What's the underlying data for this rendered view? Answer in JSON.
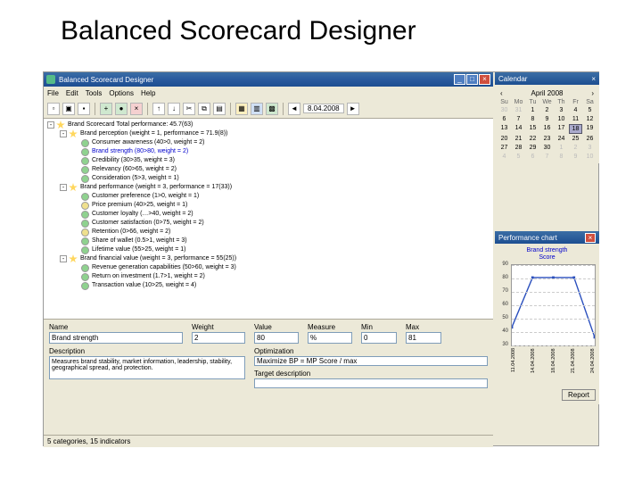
{
  "slide_title": "Balanced Scorecard Designer",
  "app": {
    "title": "Balanced Scorecard Designer",
    "window_buttons": {
      "min": "_",
      "max": "□",
      "close": "×"
    },
    "menu": [
      "File",
      "Edit",
      "Tools",
      "Options",
      "Help"
    ],
    "toolbar_date": "8.04.2008",
    "tree": [
      {
        "indent": 0,
        "exp": "-",
        "icon": "star",
        "text": "Brand Scorecard Total performance: 45.7(63)"
      },
      {
        "indent": 1,
        "exp": "-",
        "icon": "star",
        "text": "Brand perception (weight = 1, performance = 71.9(8))"
      },
      {
        "indent": 2,
        "exp": "",
        "icon": "green",
        "text": "Consumer awareness (40>0, weight = 2)"
      },
      {
        "indent": 2,
        "exp": "",
        "icon": "green",
        "text": "Brand strength (80>80, weight = 2)",
        "blue": true
      },
      {
        "indent": 2,
        "exp": "",
        "icon": "green",
        "text": "Credibility (30>35, weight = 3)"
      },
      {
        "indent": 2,
        "exp": "",
        "icon": "green",
        "text": "Relevancy (60>65, weight = 2)"
      },
      {
        "indent": 2,
        "exp": "",
        "icon": "green",
        "text": "Consideration (5>3, weight = 1)"
      },
      {
        "indent": 1,
        "exp": "-",
        "icon": "star",
        "text": "Brand performance (weight = 3, performance = 17(33))"
      },
      {
        "indent": 2,
        "exp": "",
        "icon": "green",
        "text": "Customer preference (1>0, weight = 1)"
      },
      {
        "indent": 2,
        "exp": "",
        "icon": "yellow",
        "text": "Price premium (40>25, weight = 1)"
      },
      {
        "indent": 2,
        "exp": "",
        "icon": "green",
        "text": "Customer loyalty (…>40, weight = 2)"
      },
      {
        "indent": 2,
        "exp": "",
        "icon": "green",
        "text": "Customer satisfaction (0>75, weight = 2)"
      },
      {
        "indent": 2,
        "exp": "",
        "icon": "yellow",
        "text": "Retention (0>66, weight = 2)"
      },
      {
        "indent": 2,
        "exp": "",
        "icon": "green",
        "text": "Share of wallet (0.5>1, weight = 3)"
      },
      {
        "indent": 2,
        "exp": "",
        "icon": "green",
        "text": "Lifetime value (55>25, weight = 1)"
      },
      {
        "indent": 1,
        "exp": "-",
        "icon": "star",
        "text": "Brand financial value (weight = 3, performance = 55(25))"
      },
      {
        "indent": 2,
        "exp": "",
        "icon": "green",
        "text": "Revenue generation capabilities (50>60, weight = 3)"
      },
      {
        "indent": 2,
        "exp": "",
        "icon": "green",
        "text": "Return on investment (1.7>1, weight = 2)"
      },
      {
        "indent": 2,
        "exp": "",
        "icon": "green",
        "text": "Transaction value (10>25, weight = 4)"
      }
    ],
    "form": {
      "labels": {
        "name": "Name",
        "weight": "Weight",
        "value": "Value",
        "measure": "Measure",
        "min": "Min",
        "max": "Max",
        "description": "Description",
        "optimization": "Optimization",
        "target_description": "Target description"
      },
      "name": "Brand strength",
      "weight": "2",
      "value": "80",
      "measure": "%",
      "min": "0",
      "max": "81",
      "description": "Measures brand stability, market information, leadership, stability, geographical spread, and protection.",
      "optimization": "Maximize BP = MP Score / max",
      "target_description": ""
    },
    "statusbar": "5 categories, 15 indicators"
  },
  "calendar": {
    "title": "Calendar",
    "close": "×",
    "month": "April 2008",
    "prev": "‹",
    "next": "›",
    "weekdays": [
      "Su",
      "Mo",
      "Tu",
      "We",
      "Th",
      "Fr",
      "Sa"
    ],
    "rows": [
      [
        "30",
        "31",
        "1",
        "2",
        "3",
        "4",
        "5"
      ],
      [
        "6",
        "7",
        "8",
        "9",
        "10",
        "11",
        "12"
      ],
      [
        "13",
        "14",
        "15",
        "16",
        "17",
        "18",
        "19"
      ],
      [
        "20",
        "21",
        "22",
        "23",
        "24",
        "25",
        "26"
      ],
      [
        "27",
        "28",
        "29",
        "30",
        "1",
        "2",
        "3"
      ],
      [
        "4",
        "5",
        "6",
        "7",
        "8",
        "9",
        "10"
      ]
    ],
    "today": "18"
  },
  "chart_window": {
    "title": "Performance chart",
    "close": "×",
    "heading": "Brand strength\nScore",
    "report_btn": "Report"
  },
  "chart_data": {
    "type": "line",
    "title": "Brand strength Score",
    "xlabel": "",
    "ylabel": "",
    "ylim": [
      30,
      90
    ],
    "x": [
      "11.04.2008",
      "14.04.2008",
      "18.04.2008",
      "21.04.2008",
      "24.04.2008"
    ],
    "values": [
      40,
      80,
      80,
      80,
      32
    ]
  }
}
